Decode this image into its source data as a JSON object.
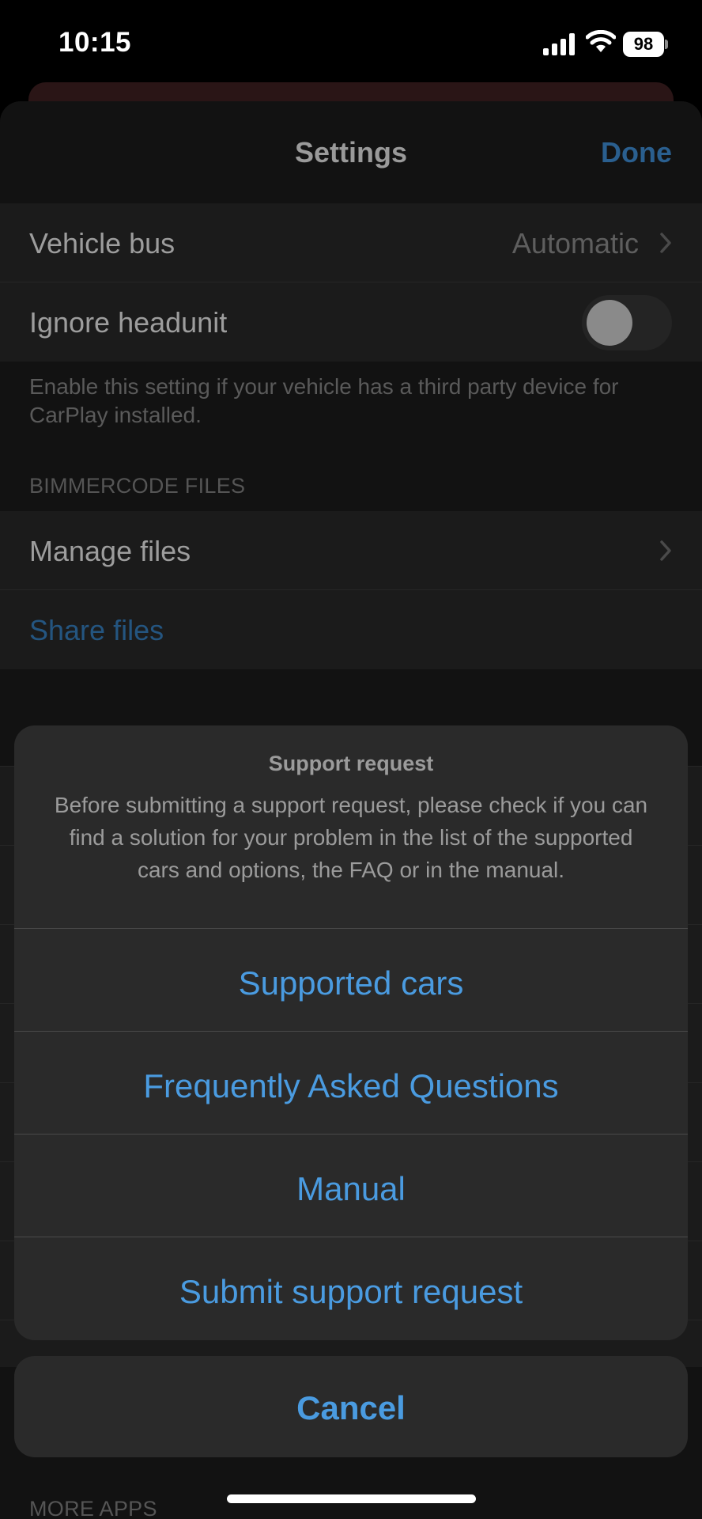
{
  "status_bar": {
    "time": "10:15",
    "battery": "98"
  },
  "settings": {
    "title": "Settings",
    "done_label": "Done",
    "vehicle_bus": {
      "label": "Vehicle bus",
      "value": "Automatic"
    },
    "ignore_headunit": {
      "label": "Ignore headunit",
      "enabled": false
    },
    "ignore_headunit_footnote": "Enable this setting if your vehicle has a third party device for CarPlay installed.",
    "files_section_header": "BIMMERCODE FILES",
    "manage_files_label": "Manage files",
    "share_files_label": "Share files",
    "more_apps_header": "MORE APPS"
  },
  "action_sheet": {
    "title": "Support request",
    "message": "Before submitting a support request, please check if you can find a solution for your problem in the list of the supported cars and options, the FAQ or in the manual.",
    "buttons": [
      {
        "label": "Supported cars"
      },
      {
        "label": "Frequently Asked Questions"
      },
      {
        "label": "Manual"
      },
      {
        "label": "Submit support request"
      }
    ],
    "cancel_label": "Cancel"
  },
  "colors": {
    "accent": "#4a9be0",
    "dimmed_accent": "#245580",
    "sheet_background": "#2a2a2a"
  }
}
